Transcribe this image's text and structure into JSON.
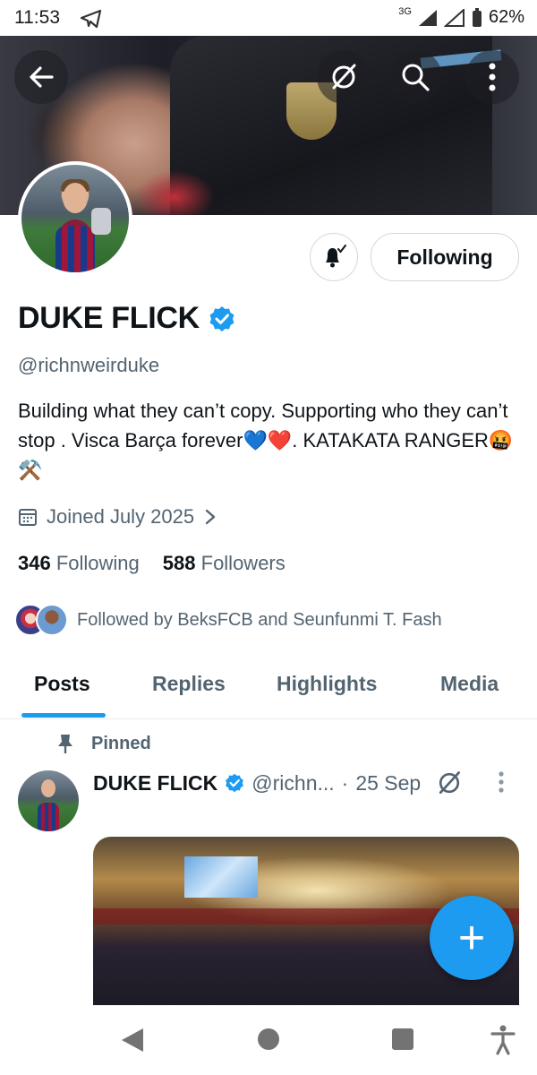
{
  "status_bar": {
    "time": "11:53",
    "network": "3G",
    "battery": "62%"
  },
  "header": {
    "back_icon": "arrow-left-icon",
    "grok_icon": "grok-icon",
    "search_icon": "search-icon",
    "more_icon": "more-vertical-icon"
  },
  "profile": {
    "name": "DUKE FLICK",
    "handle": "@richnweirduke",
    "bio": "Building what they can’t copy. Supporting who they can’t stop . Visca Barça forever💙❤️. KATAKATA RANGER🤬⚒️",
    "joined": "Joined July 2025",
    "following_count": "346",
    "following_label": "Following",
    "followers_count": "588",
    "followers_label": "Followers",
    "followed_by": "Followed by BeksFCB and Seunfunmi T. Fash"
  },
  "actions": {
    "following_button": "Following"
  },
  "tabs": [
    {
      "label": "Posts"
    },
    {
      "label": "Replies"
    },
    {
      "label": "Highlights"
    },
    {
      "label": "Media"
    }
  ],
  "pinned_tweet": {
    "pinned_label": "Pinned",
    "author": "DUKE FLICK",
    "handle": "@richn...",
    "separator": "·",
    "date": "25 Sep"
  },
  "fab": {
    "label": "+"
  },
  "colors": {
    "accent": "#1d9bf0",
    "text": "#0f1419",
    "muted": "#536471"
  }
}
